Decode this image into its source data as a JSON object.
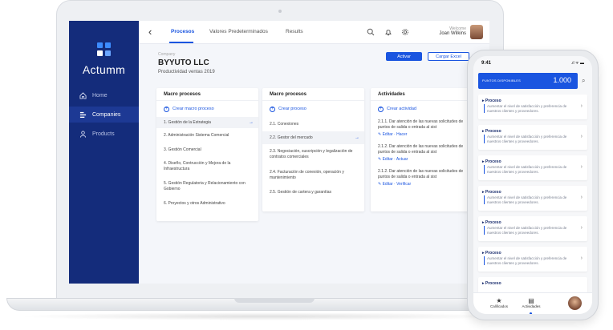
{
  "app": {
    "brand": "Actumm"
  },
  "sidebar": {
    "items": [
      {
        "label": "Home",
        "icon": "home-icon"
      },
      {
        "label": "Companies",
        "icon": "list-icon",
        "active": true
      },
      {
        "label": "Products",
        "icon": "user-icon"
      }
    ]
  },
  "topbar": {
    "tabs": [
      {
        "label": "Procesos",
        "active": true
      },
      {
        "label": "Valores Predeterminados"
      },
      {
        "label": "Results"
      }
    ],
    "welcome_label": "Welcome",
    "user_name": "Joan Wilkins",
    "icons": [
      "search-icon",
      "bell-icon",
      "gear-icon"
    ]
  },
  "header": {
    "company_label": "Company",
    "company_name": "BYYUTO LLC",
    "subtitle": "Productividad ventas 2019",
    "activate_label": "Activar",
    "upload_label": "Cargar Excel"
  },
  "columns": {
    "macro": {
      "title": "Macro procesos",
      "add_label": "Crear macro proceso",
      "items": [
        "1. Gestión de la Estrategia",
        "2. Administración Sistema Comercial",
        "3. Gestión Comercial",
        "4. Diseño, Contrucción y Mejora de la Infraestructura",
        "5. Gestión Regulatoria y Relacionamiento con Gobierno",
        "6. Proyectos y otros Administrativo"
      ]
    },
    "procesos": {
      "title": "Macro procesos",
      "add_label": "Crear proceso",
      "items": [
        "2.1. Conexiones",
        "2.2. Gestor del mercado",
        "2.3. Negociación, suscripción y legalización de contratos comerciales",
        "2.4. Facturación de conexión, operación y mantenimiento",
        "2.5. Gestión de cartera y garantías"
      ]
    },
    "actividades": {
      "title": "Actividades",
      "add_label": "Crear actividad",
      "items": [
        {
          "text": "2.1.1. Dar atención de las nuevas solicitudes de puntos de salida o entrada al sist",
          "link1": "Editar",
          "link2": "Hacer"
        },
        {
          "text": "2.1.2. Dar atención de las nuevas solicitudes de puntos de salida o entrada al sist",
          "link1": "Editar",
          "link2": "Actuar"
        },
        {
          "text": "2.1.2. Dar atención de las nuevas solicitudes de puntos de salida o entrada al sist",
          "link1": "Editar",
          "link2": "Verificar"
        }
      ]
    }
  },
  "phone": {
    "time": "9:41",
    "status_icons": ".ıl ᯤ ▬",
    "points_label": "PUNTOS DISPONIBLES",
    "points_value": "1.000",
    "cards": [
      {
        "title": "Proceso",
        "desc": "Aumentar el nivel de satisfacción y preferencia de nuestros clientes y proveedores."
      },
      {
        "title": "Proceso",
        "desc": "Aumentar el nivel de satisfacción y preferencia de nuestros clientes y proveedores."
      },
      {
        "title": "Proceso",
        "desc": "Aumentar el nivel de satisfacción y preferencia de nuestros clientes y proveedores."
      },
      {
        "title": "Proceso",
        "desc": "Aumentar el nivel de satisfacción y preferencia de nuestros clientes y proveedores."
      },
      {
        "title": "Proceso",
        "desc": "Aumentar el nivel de satisfacción y preferencia de nuestros clientes y proveedores."
      },
      {
        "title": "Proceso",
        "desc": "Aumentar el nivel de satisfacción y preferencia de nuestros clientes y proveedores."
      },
      {
        "title": "Proceso",
        "desc": ""
      }
    ],
    "tabbar": [
      {
        "label": "Calificados",
        "icon": "star-icon"
      },
      {
        "label": "Actividades",
        "icon": "document-icon"
      }
    ]
  },
  "colors": {
    "primary": "#1a55e0",
    "sidebar": "#142c7b"
  }
}
